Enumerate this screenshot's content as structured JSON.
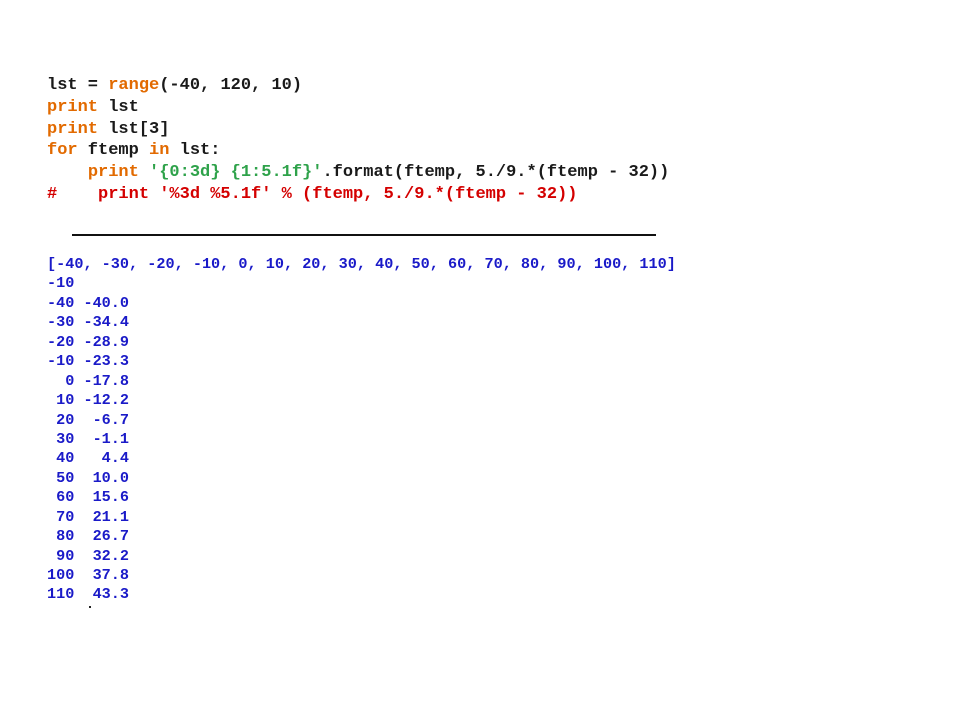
{
  "code": {
    "lines": [
      [
        {
          "text": "lst = ",
          "kind": "default"
        },
        {
          "text": "range",
          "kind": "keyword"
        },
        {
          "text": "(-40, 120, 10)",
          "kind": "default"
        }
      ],
      [
        {
          "text": "print",
          "kind": "keyword"
        },
        {
          "text": " lst",
          "kind": "default"
        }
      ],
      [
        {
          "text": "print",
          "kind": "keyword"
        },
        {
          "text": " lst[3]",
          "kind": "default"
        }
      ],
      [
        {
          "text": "for",
          "kind": "keyword"
        },
        {
          "text": " ftemp ",
          "kind": "default"
        },
        {
          "text": "in",
          "kind": "keyword"
        },
        {
          "text": " lst:",
          "kind": "default"
        }
      ],
      [
        {
          "text": "    ",
          "kind": "default"
        },
        {
          "text": "print",
          "kind": "keyword"
        },
        {
          "text": " ",
          "kind": "default"
        },
        {
          "text": "'{0:3d} {1:5.1f}'",
          "kind": "string"
        },
        {
          "text": ".format(ftemp, 5./9.*(ftemp - 32))",
          "kind": "default"
        }
      ],
      [
        {
          "text": "#    print '%3d %5.1f' % (ftemp, 5./9.*(ftemp - 32))",
          "kind": "comment"
        }
      ]
    ]
  },
  "output": {
    "lines": [
      "[-40, -30, -20, -10, 0, 10, 20, 30, 40, 50, 60, 70, 80, 90, 100, 110]",
      "-10",
      "-40 -40.0",
      "-30 -34.4",
      "-20 -28.9",
      "-10 -23.3",
      "  0 -17.8",
      " 10 -12.2",
      " 20  -6.7",
      " 30  -1.1",
      " 40   4.4",
      " 50  10.0",
      " 60  15.6",
      " 70  21.1",
      " 80  26.7",
      " 90  32.2",
      "100  37.8",
      "110  43.3"
    ]
  },
  "colors": {
    "default": "#1a1a1a",
    "keyword": "#e26a00",
    "string": "#2ea24a",
    "comment": "#d40000",
    "output": "#1a1ac8"
  }
}
